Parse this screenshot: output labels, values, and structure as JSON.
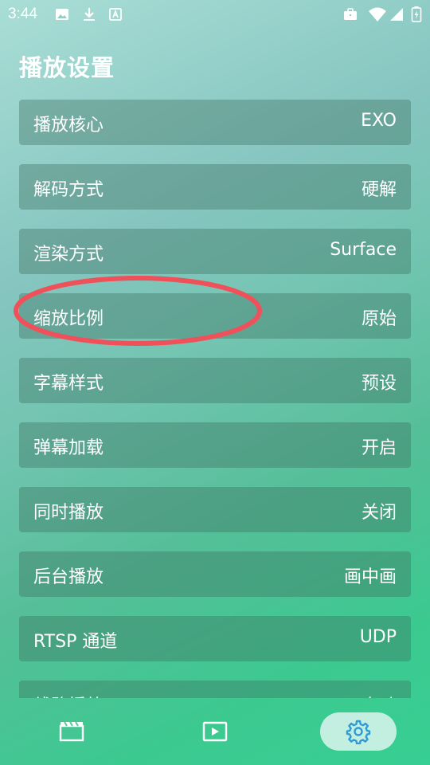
{
  "status_bar": {
    "time": "3:44",
    "icons": [
      "image-icon",
      "download-icon",
      "a-box-icon",
      "briefcase-icon",
      "wifi-icon",
      "signal-icon",
      "battery-icon"
    ]
  },
  "page": {
    "title": "播放设置"
  },
  "settings": [
    {
      "label": "播放核心",
      "value": "EXO"
    },
    {
      "label": "解码方式",
      "value": "硬解"
    },
    {
      "label": "渲染方式",
      "value": "Surface"
    },
    {
      "label": "缩放比例",
      "value": "原始"
    },
    {
      "label": "字幕样式",
      "value": "预设"
    },
    {
      "label": "弹幕加载",
      "value": "开启"
    },
    {
      "label": "同时播放",
      "value": "关闭"
    },
    {
      "label": "后台播放",
      "value": "画中画"
    },
    {
      "label": "RTSP 通道",
      "value": "UDP"
    },
    {
      "label": "线路播放",
      "value": "自动"
    }
  ],
  "annotation": {
    "shape": "ellipse",
    "color": "#f0505a",
    "target": "缩放比例"
  },
  "bottom_nav": {
    "items": [
      "film-icon",
      "play-icon",
      "gear-icon"
    ],
    "active": "gear-icon",
    "active_color": "#2f9ad6"
  }
}
